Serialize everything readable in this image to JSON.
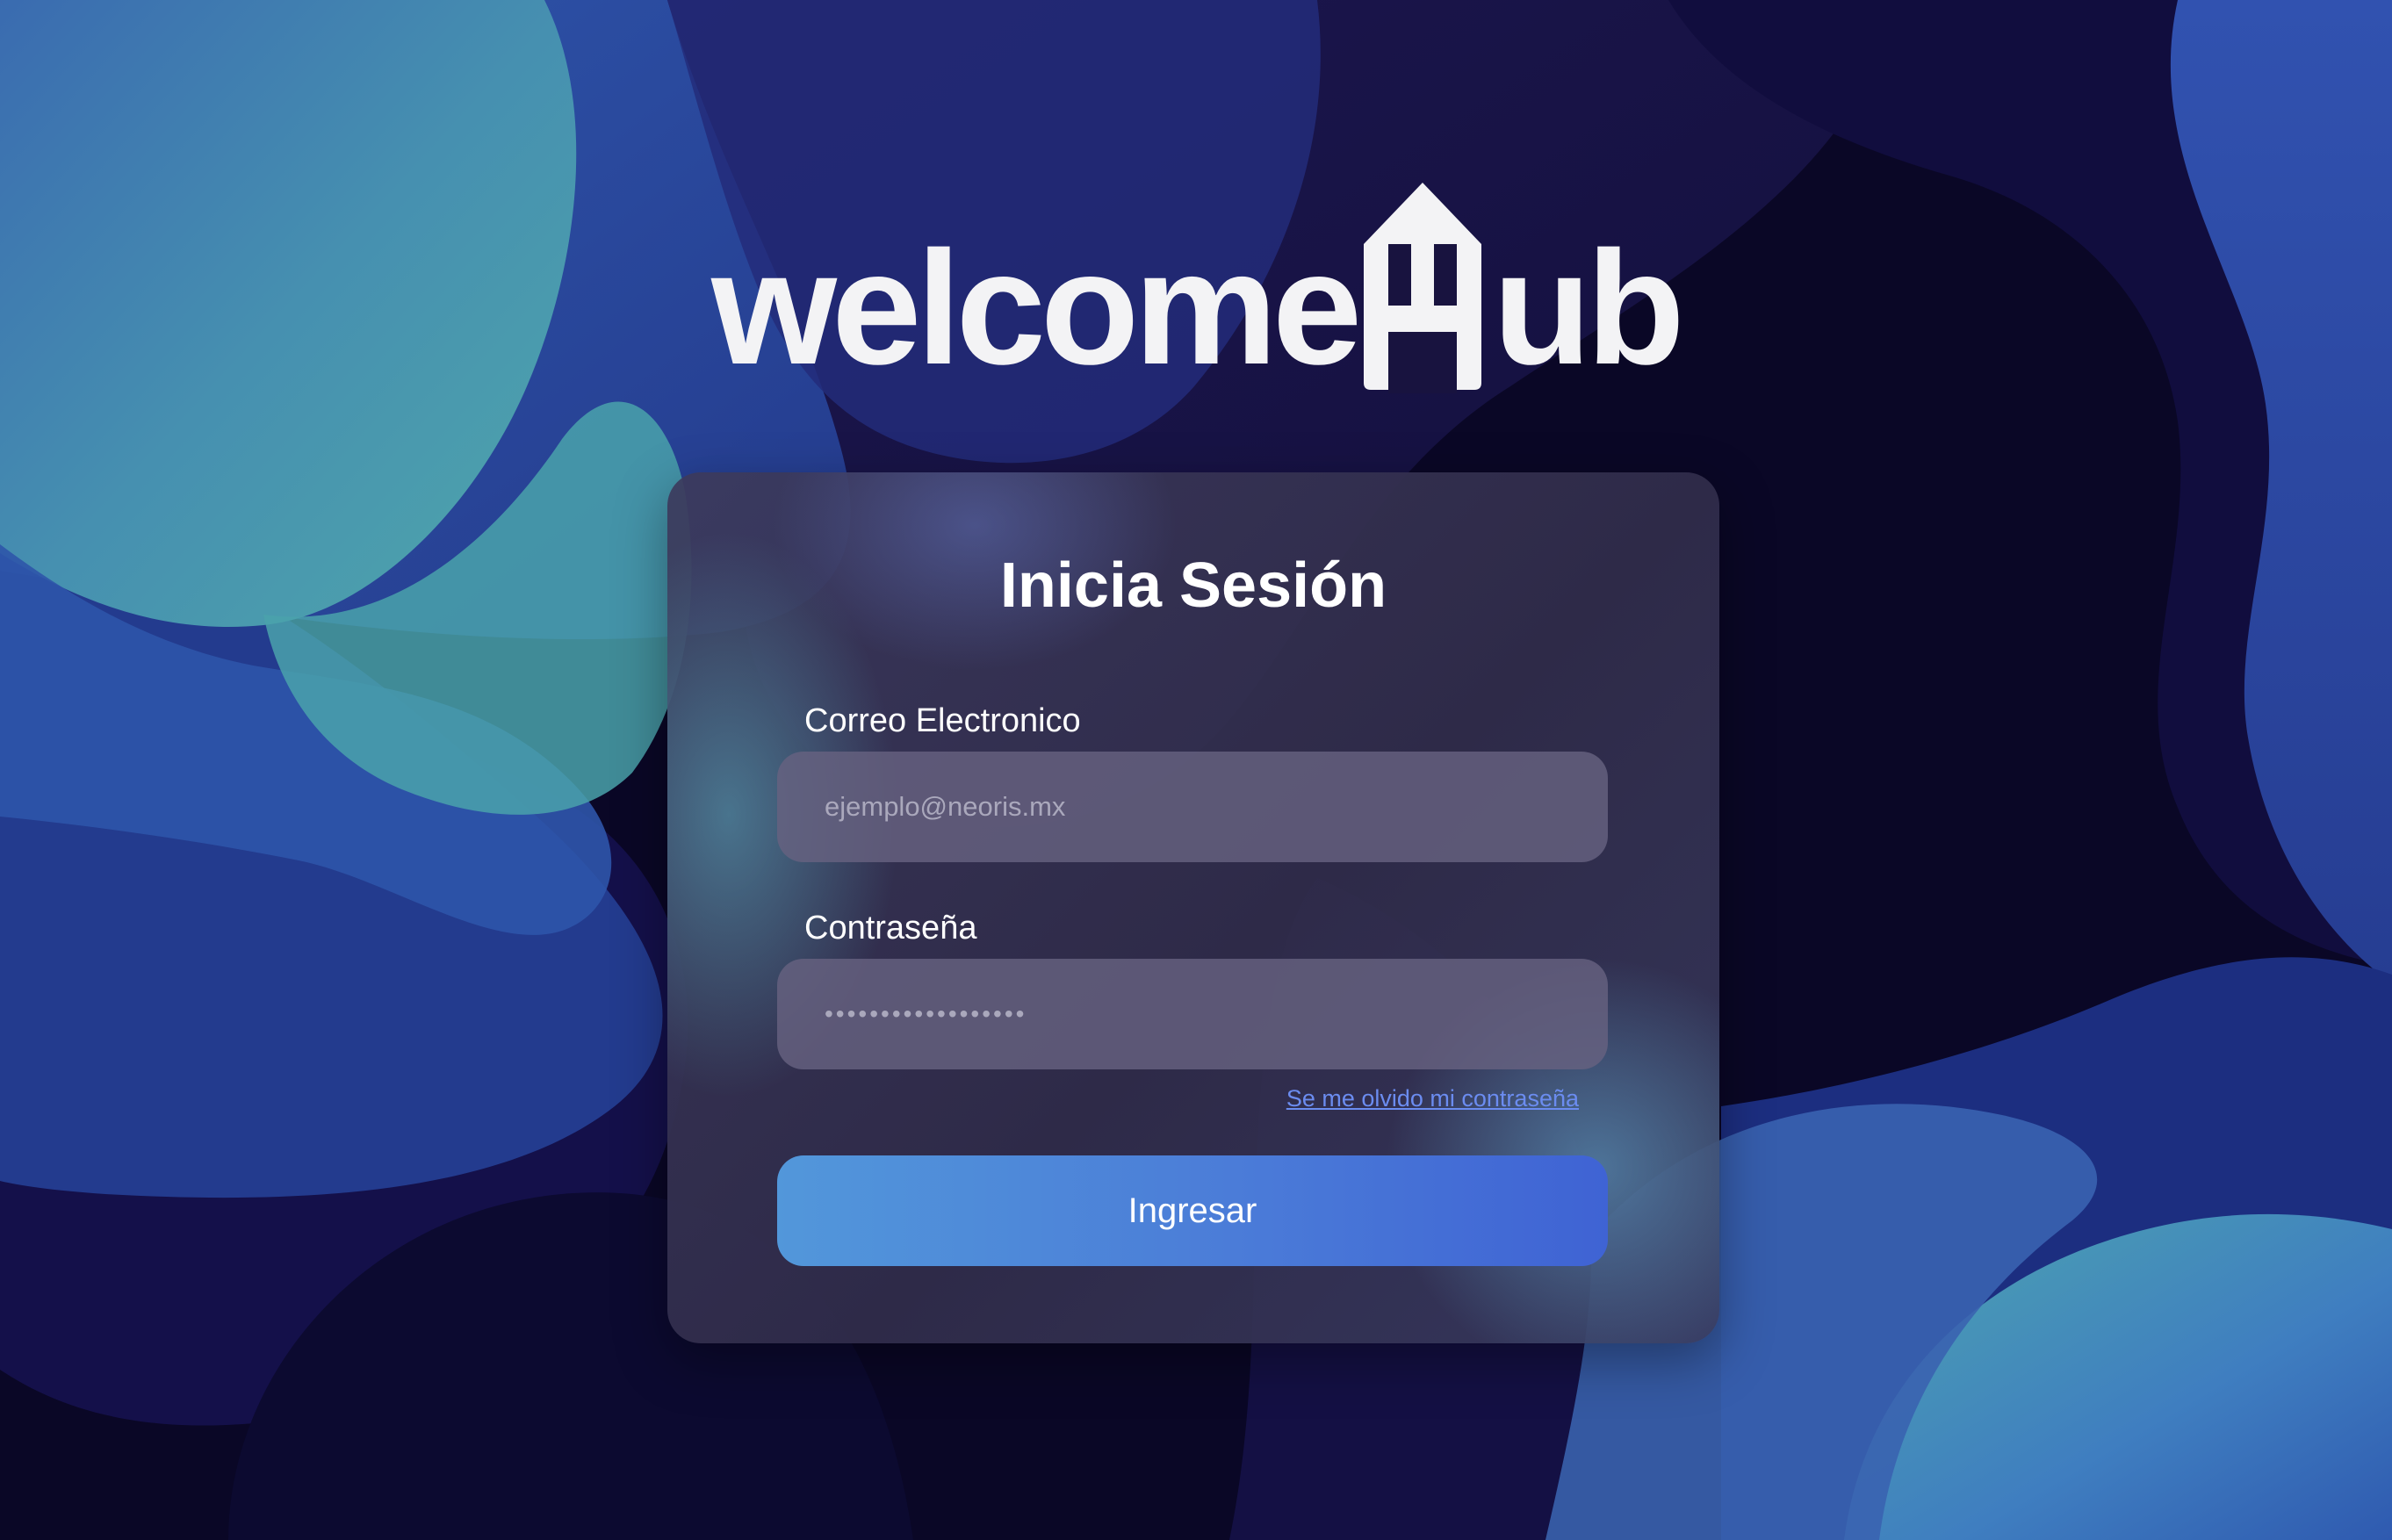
{
  "logo": {
    "text_left": "welcome",
    "text_right": "ub",
    "house_letter": "H"
  },
  "login": {
    "title": "Inicia Sesión",
    "email_label": "Correo Electronico",
    "email_placeholder": "ejemplo@neoris.mx",
    "password_label": "Contraseña",
    "password_placeholder": "••••••••••••••••••",
    "forgot_link": "Se me olvido mi contraseña",
    "submit_label": "Ingresar"
  },
  "colors": {
    "background_dark": "#0a0726",
    "background_blue": "#2b4aa0",
    "background_teal": "#4aa3a8",
    "accent_button": "#4b7cd8",
    "link": "#6b8cf0"
  }
}
